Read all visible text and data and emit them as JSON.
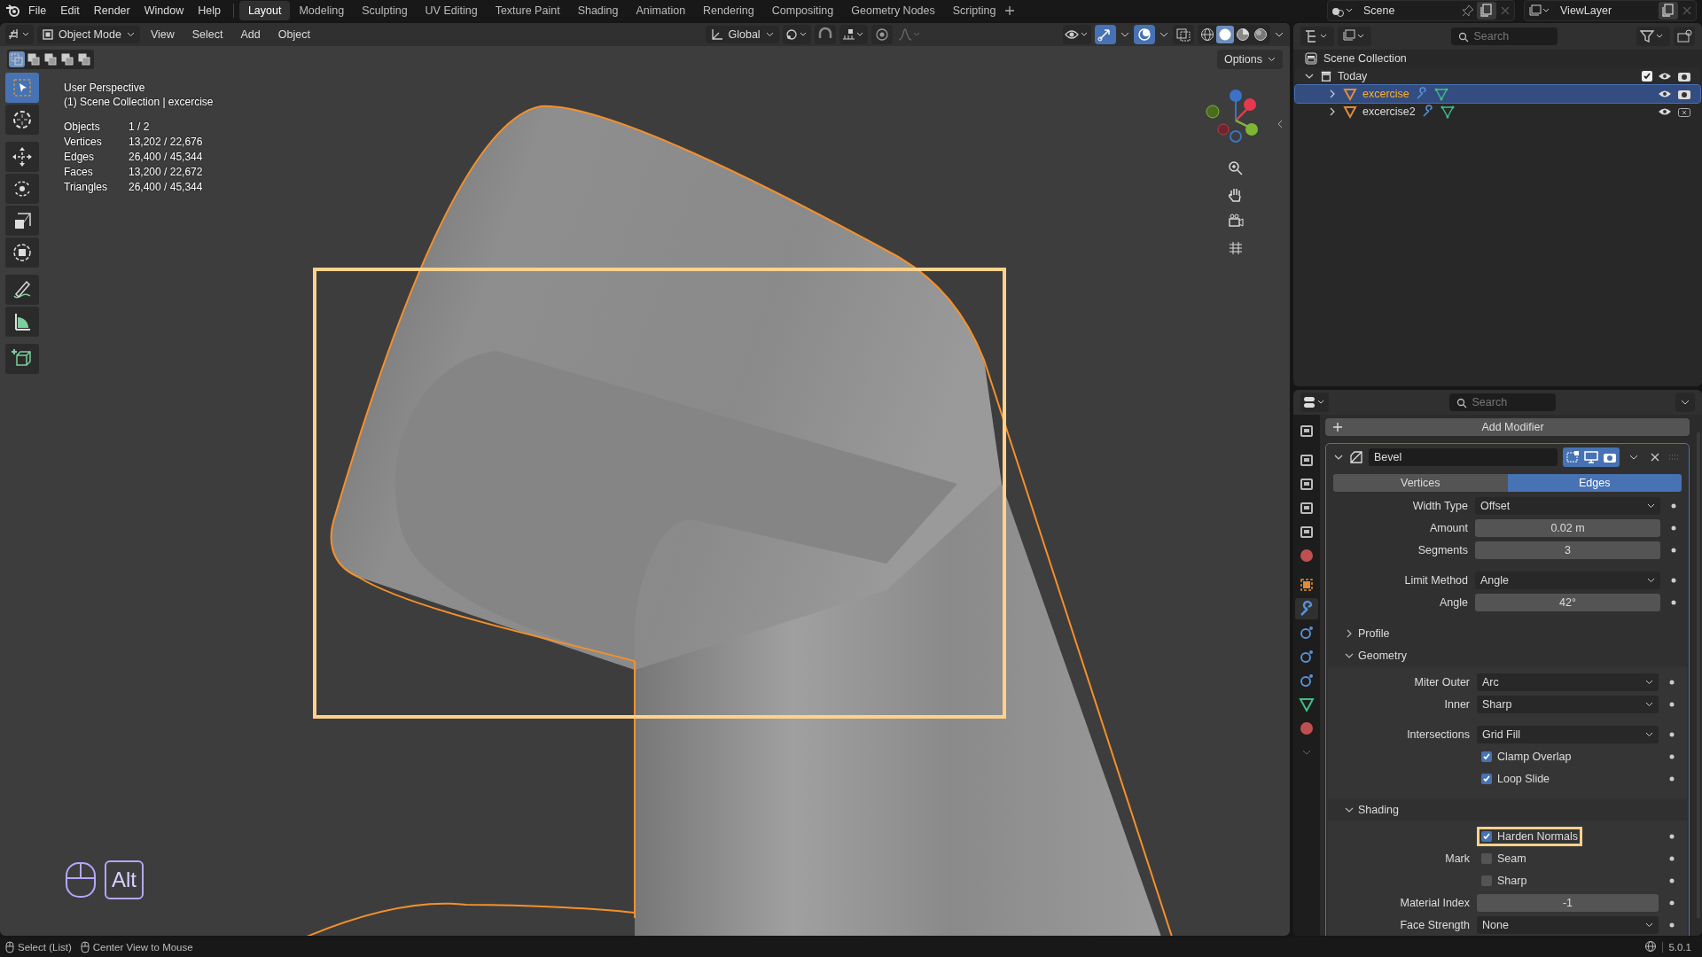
{
  "menu_bar": {
    "menus": [
      "File",
      "Edit",
      "Render",
      "Window",
      "Help"
    ],
    "workspaces": [
      {
        "label": "Layout",
        "selected": true
      },
      {
        "label": "Modeling",
        "selected": false
      },
      {
        "label": "Sculpting",
        "selected": false
      },
      {
        "label": "UV Editing",
        "selected": false
      },
      {
        "label": "Texture Paint",
        "selected": false
      },
      {
        "label": "Shading",
        "selected": false
      },
      {
        "label": "Animation",
        "selected": false
      },
      {
        "label": "Rendering",
        "selected": false
      },
      {
        "label": "Compositing",
        "selected": false
      },
      {
        "label": "Geometry Nodes",
        "selected": false
      },
      {
        "label": "Scripting",
        "selected": false
      }
    ],
    "scene": "Scene",
    "view_layer": "ViewLayer"
  },
  "viewport_header": {
    "mode": "Object Mode",
    "menus": [
      "View",
      "Select",
      "Add",
      "Object"
    ],
    "orientation": "Global",
    "options": "Options"
  },
  "viewport": {
    "view_name": "User Perspective",
    "context": "(1) Scene Collection | excercise",
    "stats": [
      {
        "label": "Objects",
        "value": "1 / 2"
      },
      {
        "label": "Vertices",
        "value": "13,202 / 22,676"
      },
      {
        "label": "Edges",
        "value": "26,400 / 45,344"
      },
      {
        "label": "Faces",
        "value": "13,200 / 22,672"
      },
      {
        "label": "Triangles",
        "value": "26,400 / 45,344"
      }
    ],
    "key_hint": "Alt"
  },
  "outliner": {
    "search_placeholder": "Search",
    "root": "Scene Collection",
    "collections": [
      {
        "label": "Today",
        "expanded": true,
        "checked": true,
        "children": [
          {
            "label": "excercise",
            "selected": true,
            "expanded": false,
            "render_enabled": true
          },
          {
            "label": "excercise2",
            "selected": false,
            "expanded": false,
            "render_enabled": false
          }
        ]
      }
    ]
  },
  "properties": {
    "search_placeholder": "Search",
    "add_modifier": "Add Modifier",
    "modifier": {
      "name": "Bevel",
      "expanded": true,
      "affect_tabs": [
        {
          "label": "Vertices",
          "selected": false
        },
        {
          "label": "Edges",
          "selected": true
        }
      ],
      "groups": [
        [
          {
            "kind": "dropdown",
            "label": "Width Type",
            "value": "Offset"
          },
          {
            "kind": "number",
            "label": "Amount",
            "value": "0.02 m"
          },
          {
            "kind": "number",
            "label": "Segments",
            "value": "3"
          }
        ],
        [
          {
            "kind": "dropdown",
            "label": "Limit Method",
            "value": "Angle"
          },
          {
            "kind": "number",
            "label": "Angle",
            "value": "42°"
          }
        ]
      ],
      "sections": [
        {
          "title": "Profile",
          "expanded": false
        },
        {
          "title": "Geometry",
          "expanded": true,
          "groups": [
            [
              {
                "kind": "dropdown",
                "label": "Miter Outer",
                "value": "Arc"
              },
              {
                "kind": "dropdown",
                "label": "Inner",
                "value": "Sharp"
              }
            ],
            [
              {
                "kind": "dropdown",
                "label": "Intersections",
                "value": "Grid Fill"
              },
              {
                "kind": "checkbox",
                "text": "Clamp Overlap",
                "checked": true,
                "highlighted": false
              },
              {
                "kind": "checkbox",
                "text": "Loop Slide",
                "checked": true,
                "highlighted": false
              }
            ]
          ]
        },
        {
          "title": "Shading",
          "expanded": true,
          "groups": [
            [
              {
                "kind": "checkbox",
                "text": "Harden Normals",
                "checked": true,
                "highlighted": true
              },
              {
                "kind": "checkbox",
                "label": "Mark",
                "text": "Seam",
                "checked": false,
                "highlighted": false
              },
              {
                "kind": "checkbox",
                "text": "Sharp",
                "checked": false,
                "highlighted": false
              },
              {
                "kind": "number",
                "label": "Material Index",
                "value": "-1"
              },
              {
                "kind": "dropdown",
                "label": "Face Strength",
                "value": "None"
              }
            ]
          ]
        }
      ]
    }
  },
  "status_bar": {
    "hints": [
      "Select (List)",
      "Center View to Mouse"
    ],
    "version": "5.0.1"
  }
}
